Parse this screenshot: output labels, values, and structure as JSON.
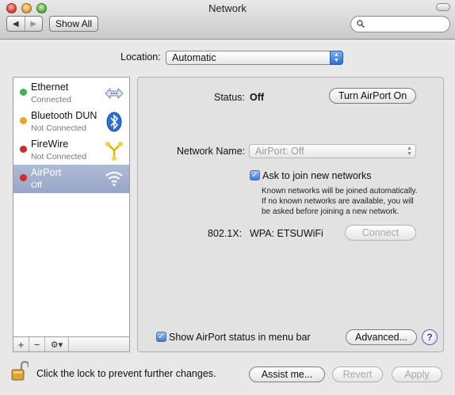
{
  "window": {
    "title": "Network"
  },
  "toolbar": {
    "back_glyph": "◀",
    "forward_glyph": "▶",
    "show_all_label": "Show All",
    "search_placeholder": ""
  },
  "location": {
    "label": "Location:",
    "value": "Automatic"
  },
  "services": [
    {
      "name": "Ethernet",
      "status": "Connected",
      "dot_color": "#3bb54a",
      "icon": "ethernet-arrows-icon"
    },
    {
      "name": "Bluetooth DUN",
      "status": "Not Connected",
      "dot_color": "#f0a020",
      "icon": "bluetooth-icon"
    },
    {
      "name": "FireWire",
      "status": "Not Connected",
      "dot_color": "#d8262b",
      "icon": "firewire-icon"
    },
    {
      "name": "AirPort",
      "status": "Off",
      "dot_color": "#d8262b",
      "icon": "wifi-icon",
      "selected": true
    }
  ],
  "sidebar_footer": {
    "add": "+",
    "remove": "−",
    "action": "⚙▾"
  },
  "panel": {
    "status_label": "Status:",
    "status_value": "Off",
    "turn_on_label": "Turn AirPort On",
    "network_name_label": "Network Name:",
    "network_name_value": "AirPort: Off",
    "ask_join_label": "Ask to join new networks",
    "ask_join_checked": true,
    "ask_join_note_1": "Known networks will be joined automatically.",
    "ask_join_note_2": "If no known networks are available, you will",
    "ask_join_note_3": "be asked before joining a new network.",
    "dot1x_label": "802.1X:",
    "dot1x_value": "WPA: ETSUWiFi",
    "connect_label": "Connect",
    "show_status_label": "Show AirPort status in menu bar",
    "show_status_checked": true,
    "advanced_label": "Advanced...",
    "help_label": "?"
  },
  "footer": {
    "lock_text": "Click the lock to prevent further changes.",
    "assist_label": "Assist me...",
    "revert_label": "Revert",
    "apply_label": "Apply"
  }
}
